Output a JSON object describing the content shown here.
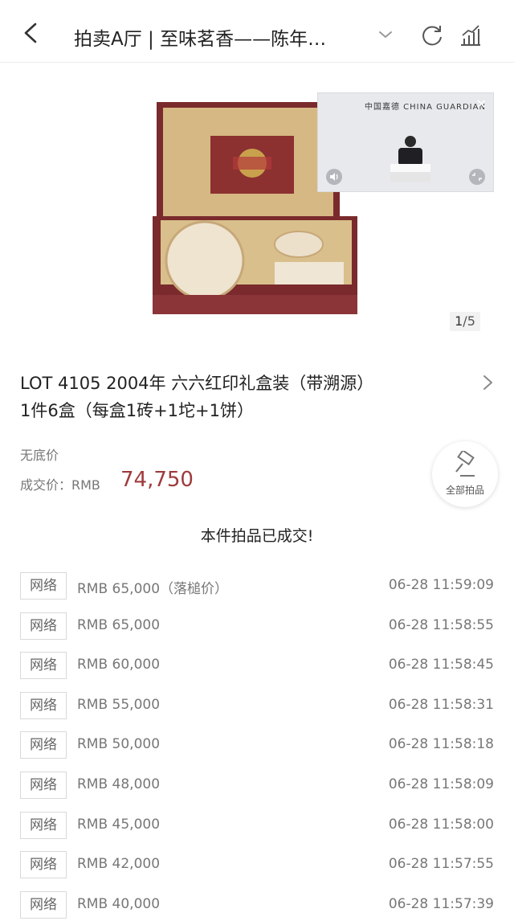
{
  "header": {
    "title": "拍卖A厅 | 至味茗香——陈年…"
  },
  "image": {
    "page_current": "1",
    "page_total": "/5",
    "live_logo": "中国嘉德 CHINA GUARDIAN"
  },
  "lot": {
    "title_line1": "LOT 4105 2004年 六六红印礼盒装（带溯源）",
    "title_line2": "1件6盒（每盒1砖+1坨+1饼）",
    "reserve": "无底价",
    "final_label": "成交价：RMB",
    "final_price": "74,750",
    "all_lots_label": "全部拍品"
  },
  "sold_message": "本件拍品已成交!",
  "bids": [
    {
      "channel": "网络",
      "amount": "RMB 65,000（落槌价）",
      "time": "06-28 11:59:09"
    },
    {
      "channel": "网络",
      "amount": "RMB 65,000",
      "time": "06-28 11:58:55"
    },
    {
      "channel": "网络",
      "amount": "RMB 60,000",
      "time": "06-28 11:58:45"
    },
    {
      "channel": "网络",
      "amount": "RMB 55,000",
      "time": "06-28 11:58:31"
    },
    {
      "channel": "网络",
      "amount": "RMB 50,000",
      "time": "06-28 11:58:18"
    },
    {
      "channel": "网络",
      "amount": "RMB 48,000",
      "time": "06-28 11:58:09"
    },
    {
      "channel": "网络",
      "amount": "RMB 45,000",
      "time": "06-28 11:58:00"
    },
    {
      "channel": "网络",
      "amount": "RMB 42,000",
      "time": "06-28 11:57:55"
    },
    {
      "channel": "网络",
      "amount": "RMB 40,000",
      "time": "06-28 11:57:39"
    }
  ]
}
